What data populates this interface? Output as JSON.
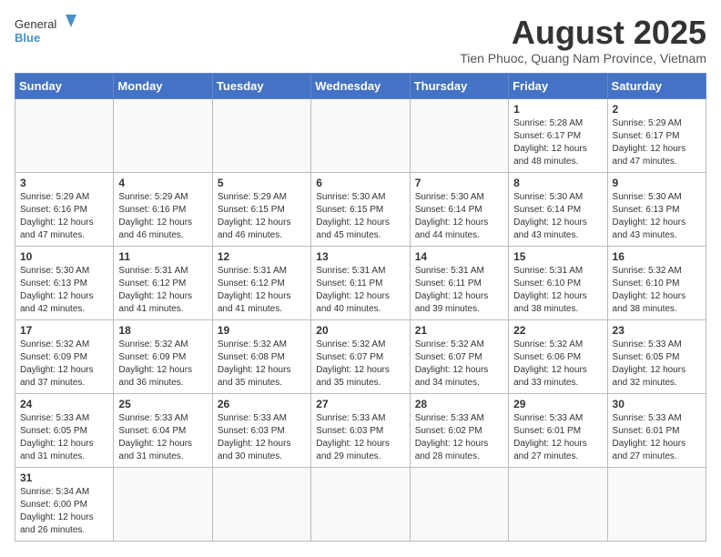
{
  "header": {
    "logo_general": "General",
    "logo_blue": "Blue",
    "title": "August 2025",
    "subtitle": "Tien Phuoc, Quang Nam Province, Vietnam"
  },
  "weekdays": [
    "Sunday",
    "Monday",
    "Tuesday",
    "Wednesday",
    "Thursday",
    "Friday",
    "Saturday"
  ],
  "weeks": [
    [
      {
        "day": "",
        "info": ""
      },
      {
        "day": "",
        "info": ""
      },
      {
        "day": "",
        "info": ""
      },
      {
        "day": "",
        "info": ""
      },
      {
        "day": "",
        "info": ""
      },
      {
        "day": "1",
        "info": "Sunrise: 5:28 AM\nSunset: 6:17 PM\nDaylight: 12 hours\nand 48 minutes."
      },
      {
        "day": "2",
        "info": "Sunrise: 5:29 AM\nSunset: 6:17 PM\nDaylight: 12 hours\nand 47 minutes."
      }
    ],
    [
      {
        "day": "3",
        "info": "Sunrise: 5:29 AM\nSunset: 6:16 PM\nDaylight: 12 hours\nand 47 minutes."
      },
      {
        "day": "4",
        "info": "Sunrise: 5:29 AM\nSunset: 6:16 PM\nDaylight: 12 hours\nand 46 minutes."
      },
      {
        "day": "5",
        "info": "Sunrise: 5:29 AM\nSunset: 6:15 PM\nDaylight: 12 hours\nand 46 minutes."
      },
      {
        "day": "6",
        "info": "Sunrise: 5:30 AM\nSunset: 6:15 PM\nDaylight: 12 hours\nand 45 minutes."
      },
      {
        "day": "7",
        "info": "Sunrise: 5:30 AM\nSunset: 6:14 PM\nDaylight: 12 hours\nand 44 minutes."
      },
      {
        "day": "8",
        "info": "Sunrise: 5:30 AM\nSunset: 6:14 PM\nDaylight: 12 hours\nand 43 minutes."
      },
      {
        "day": "9",
        "info": "Sunrise: 5:30 AM\nSunset: 6:13 PM\nDaylight: 12 hours\nand 43 minutes."
      }
    ],
    [
      {
        "day": "10",
        "info": "Sunrise: 5:30 AM\nSunset: 6:13 PM\nDaylight: 12 hours\nand 42 minutes."
      },
      {
        "day": "11",
        "info": "Sunrise: 5:31 AM\nSunset: 6:12 PM\nDaylight: 12 hours\nand 41 minutes."
      },
      {
        "day": "12",
        "info": "Sunrise: 5:31 AM\nSunset: 6:12 PM\nDaylight: 12 hours\nand 41 minutes."
      },
      {
        "day": "13",
        "info": "Sunrise: 5:31 AM\nSunset: 6:11 PM\nDaylight: 12 hours\nand 40 minutes."
      },
      {
        "day": "14",
        "info": "Sunrise: 5:31 AM\nSunset: 6:11 PM\nDaylight: 12 hours\nand 39 minutes."
      },
      {
        "day": "15",
        "info": "Sunrise: 5:31 AM\nSunset: 6:10 PM\nDaylight: 12 hours\nand 38 minutes."
      },
      {
        "day": "16",
        "info": "Sunrise: 5:32 AM\nSunset: 6:10 PM\nDaylight: 12 hours\nand 38 minutes."
      }
    ],
    [
      {
        "day": "17",
        "info": "Sunrise: 5:32 AM\nSunset: 6:09 PM\nDaylight: 12 hours\nand 37 minutes."
      },
      {
        "day": "18",
        "info": "Sunrise: 5:32 AM\nSunset: 6:09 PM\nDaylight: 12 hours\nand 36 minutes."
      },
      {
        "day": "19",
        "info": "Sunrise: 5:32 AM\nSunset: 6:08 PM\nDaylight: 12 hours\nand 35 minutes."
      },
      {
        "day": "20",
        "info": "Sunrise: 5:32 AM\nSunset: 6:07 PM\nDaylight: 12 hours\nand 35 minutes."
      },
      {
        "day": "21",
        "info": "Sunrise: 5:32 AM\nSunset: 6:07 PM\nDaylight: 12 hours\nand 34 minutes."
      },
      {
        "day": "22",
        "info": "Sunrise: 5:32 AM\nSunset: 6:06 PM\nDaylight: 12 hours\nand 33 minutes."
      },
      {
        "day": "23",
        "info": "Sunrise: 5:33 AM\nSunset: 6:05 PM\nDaylight: 12 hours\nand 32 minutes."
      }
    ],
    [
      {
        "day": "24",
        "info": "Sunrise: 5:33 AM\nSunset: 6:05 PM\nDaylight: 12 hours\nand 31 minutes."
      },
      {
        "day": "25",
        "info": "Sunrise: 5:33 AM\nSunset: 6:04 PM\nDaylight: 12 hours\nand 31 minutes."
      },
      {
        "day": "26",
        "info": "Sunrise: 5:33 AM\nSunset: 6:03 PM\nDaylight: 12 hours\nand 30 minutes."
      },
      {
        "day": "27",
        "info": "Sunrise: 5:33 AM\nSunset: 6:03 PM\nDaylight: 12 hours\nand 29 minutes."
      },
      {
        "day": "28",
        "info": "Sunrise: 5:33 AM\nSunset: 6:02 PM\nDaylight: 12 hours\nand 28 minutes."
      },
      {
        "day": "29",
        "info": "Sunrise: 5:33 AM\nSunset: 6:01 PM\nDaylight: 12 hours\nand 27 minutes."
      },
      {
        "day": "30",
        "info": "Sunrise: 5:33 AM\nSunset: 6:01 PM\nDaylight: 12 hours\nand 27 minutes."
      }
    ],
    [
      {
        "day": "31",
        "info": "Sunrise: 5:34 AM\nSunset: 6:00 PM\nDaylight: 12 hours\nand 26 minutes."
      },
      {
        "day": "",
        "info": ""
      },
      {
        "day": "",
        "info": ""
      },
      {
        "day": "",
        "info": ""
      },
      {
        "day": "",
        "info": ""
      },
      {
        "day": "",
        "info": ""
      },
      {
        "day": "",
        "info": ""
      }
    ]
  ]
}
